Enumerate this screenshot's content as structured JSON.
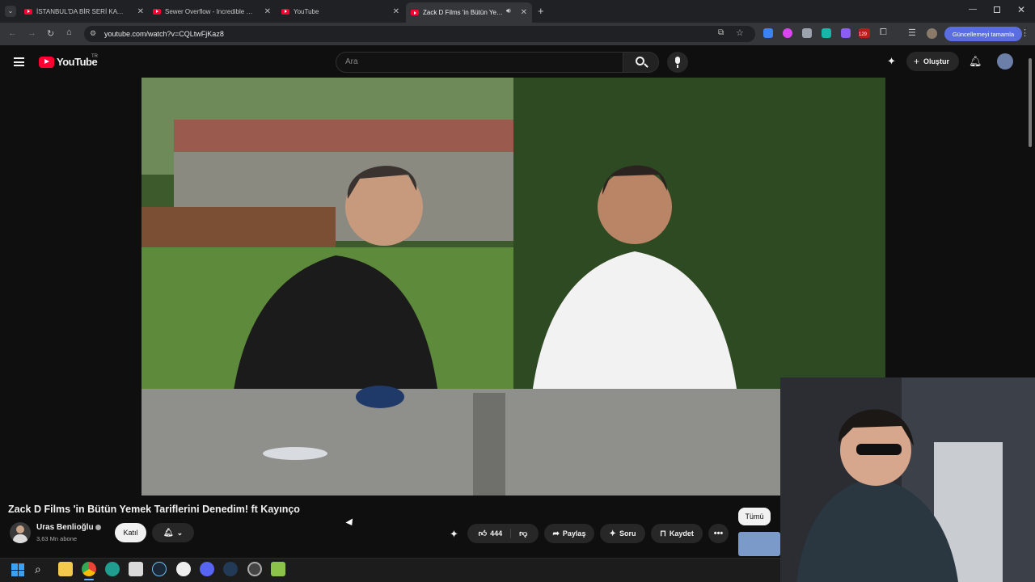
{
  "browser": {
    "tabs": [
      {
        "title": "İSTANBUL'DA BİR SERİ KATİL - ",
        "active": false
      },
      {
        "title": "Sewer Overflow - Incredible din",
        "active": false
      },
      {
        "title": "YouTube",
        "active": false
      },
      {
        "title": "Zack D Films 'in Bütün Yeme",
        "active": true
      }
    ],
    "url": "youtube.com/watch?v=CQLtwFjKaz8",
    "update_button": "Güncellemeyi tamamla",
    "extension_badge": "129"
  },
  "youtube": {
    "logo_text": "YouTube",
    "region": "TR",
    "search_placeholder": "Ara",
    "create_label": "Oluştur"
  },
  "video": {
    "title": "Zack D Films 'in Bütün Yemek Tariflerini Denedim! ft Kayınço",
    "channel": "Uras Benlioğlu",
    "subscribers": "3,63 Mn abone",
    "join_label": "Katıl",
    "likes": "444",
    "share_label": "Paylaş",
    "ask_label": "Soru",
    "save_label": "Kaydet"
  },
  "sidebar": {
    "chip_all": "Tümü"
  },
  "colors": {
    "accent": "#ff0033",
    "background": "#0f0f0f",
    "pill": "#272727",
    "update_button": "#5b6ee1"
  }
}
